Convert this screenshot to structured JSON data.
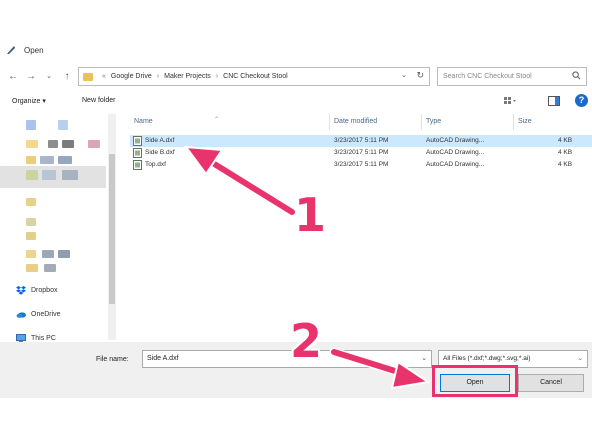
{
  "window": {
    "title": "Open",
    "icon": "app-feather-icon"
  },
  "address_bar": {
    "crumbs": [
      "Google Drive",
      "Maker Projects",
      "CNC Checkout Stool"
    ],
    "search_placeholder": "Search CNC Checkout Stool"
  },
  "toolbar": {
    "organize_label": "Organize ▾",
    "new_folder_label": "New folder",
    "help_label": "?"
  },
  "nav_pane": {
    "items": [
      {
        "label": "Dropbox",
        "icon": "dropbox-icon"
      },
      {
        "label": "OneDrive",
        "icon": "onedrive-icon"
      },
      {
        "label": "This PC",
        "icon": "pc-icon"
      }
    ]
  },
  "file_list": {
    "columns": [
      "Name",
      "Date modified",
      "Type",
      "Size"
    ],
    "rows": [
      {
        "name": "Side A.dxf",
        "date": "3/23/2017 5:11 PM",
        "type": "AutoCAD Drawing...",
        "size": "4 KB",
        "selected": true
      },
      {
        "name": "Side B.dxf",
        "date": "3/23/2017 5:11 PM",
        "type": "AutoCAD Drawing...",
        "size": "4 KB",
        "selected": false
      },
      {
        "name": "Top.dxf",
        "date": "3/23/2017 5:11 PM",
        "type": "AutoCAD Drawing...",
        "size": "4 KB",
        "selected": false
      }
    ]
  },
  "footer": {
    "file_name_label": "File name:",
    "file_name_value": "Side A.dxf",
    "filter_value": "All Files (*.dxf;*.dwg;*.svg;*.ai)",
    "open_label": "Open",
    "cancel_label": "Cancel"
  },
  "annotations": {
    "step1": "1",
    "step2": "2",
    "color": "#e8336d"
  },
  "colors": {
    "selection": "#cce8ff",
    "accent": "#0078d7"
  }
}
